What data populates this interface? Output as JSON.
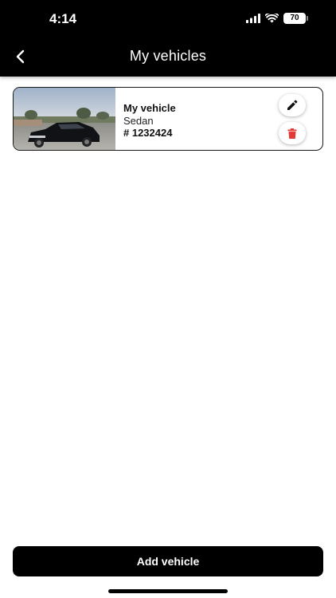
{
  "status_bar": {
    "time": "4:14",
    "battery": "70"
  },
  "header": {
    "title": "My vehicles",
    "back_icon": "chevron-left-icon"
  },
  "vehicles": [
    {
      "name": "My vehicle",
      "type": "Sedan",
      "plate": "# 1232424",
      "edit_icon": "pencil-icon",
      "delete_icon": "trash-icon"
    }
  ],
  "footer": {
    "add_label": "Add vehicle"
  },
  "colors": {
    "primary": "#000000",
    "background": "#ffffff",
    "delete": "#e53935"
  }
}
